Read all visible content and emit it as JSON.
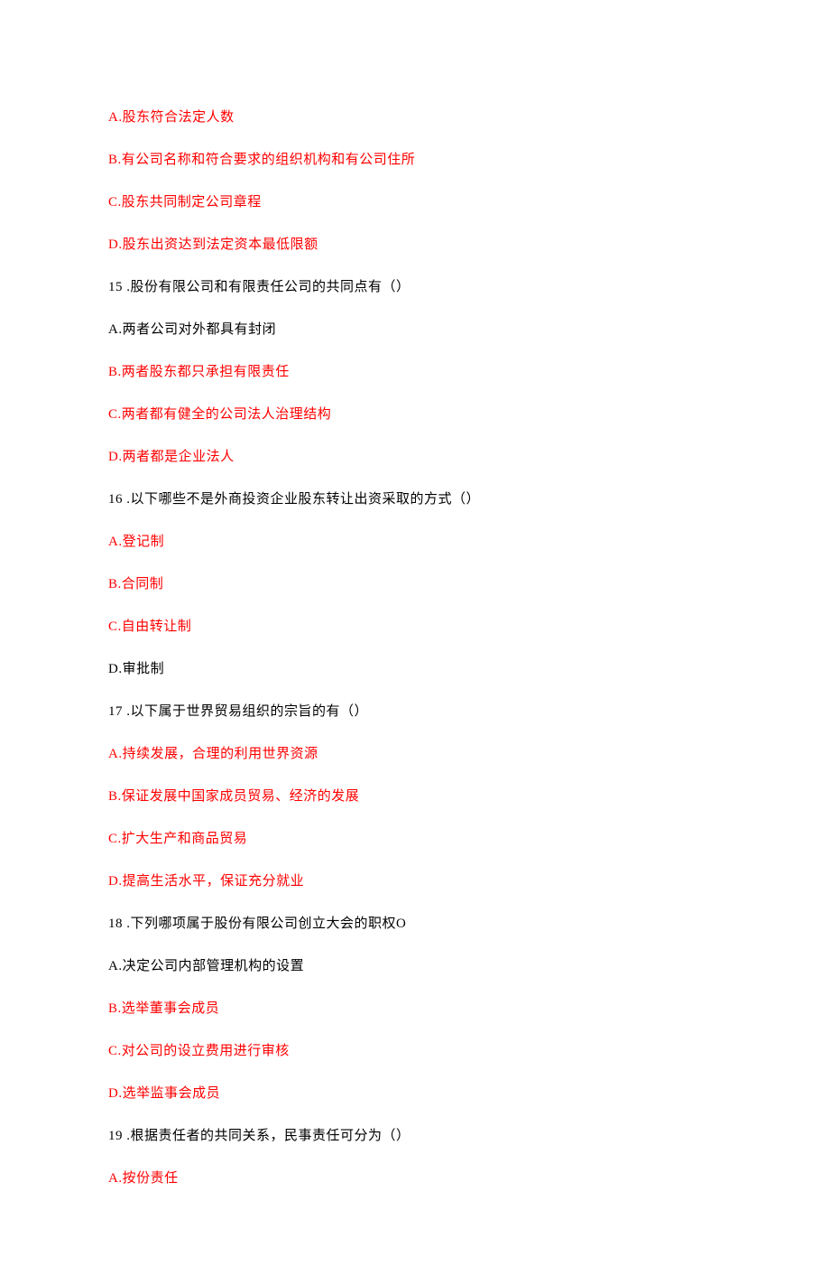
{
  "lines": [
    {
      "text": "A.股东符合法定人数",
      "color": "red"
    },
    {
      "text": "B.有公司名称和符合要求的组织机构和有公司住所",
      "color": "red"
    },
    {
      "text": "C.股东共同制定公司章程",
      "color": "red"
    },
    {
      "text": "D.股东出资达到法定资本最低限额",
      "color": "red"
    },
    {
      "text": "15    .股份有限公司和有限责任公司的共同点有（）",
      "color": "black"
    },
    {
      "text": "A.两者公司对外都具有封闭",
      "color": "black"
    },
    {
      "text": "B.两者股东都只承担有限责任",
      "color": "red"
    },
    {
      "text": "C.两者都有健全的公司法人治理结构",
      "color": "red"
    },
    {
      "text": "D.两者都是企业法人",
      "color": "red"
    },
    {
      "text": "16    .以下哪些不是外商投资企业股东转让出资采取的方式（）",
      "color": "black"
    },
    {
      "text": "A.登记制",
      "color": "red"
    },
    {
      "text": "B.合同制",
      "color": "red"
    },
    {
      "text": "C.自由转让制",
      "color": "red"
    },
    {
      "text": "D.审批制",
      "color": "black"
    },
    {
      "text": "17    .以下属于世界贸易组织的宗旨的有（）",
      "color": "black"
    },
    {
      "text": "A.持续发展，合理的利用世界资源",
      "color": "red"
    },
    {
      "text": "B.保证发展中国家成员贸易、经济的发展",
      "color": "red"
    },
    {
      "text": "C.扩大生产和商品贸易",
      "color": "red"
    },
    {
      "text": "D.提高生活水平，保证充分就业",
      "color": "red"
    },
    {
      "text": "18    .下列哪项属于股份有限公司创立大会的职权O",
      "color": "black"
    },
    {
      "text": "A.决定公司内部管理机构的设置",
      "color": "black"
    },
    {
      "text": "B.选举董事会成员",
      "color": "red"
    },
    {
      "text": "C.对公司的设立费用进行审核",
      "color": "red"
    },
    {
      "text": "D.选举监事会成员",
      "color": "red"
    },
    {
      "text": "19    .根据责任者的共同关系，民事责任可分为（）",
      "color": "black"
    },
    {
      "text": "A.按份责任",
      "color": "red"
    }
  ]
}
